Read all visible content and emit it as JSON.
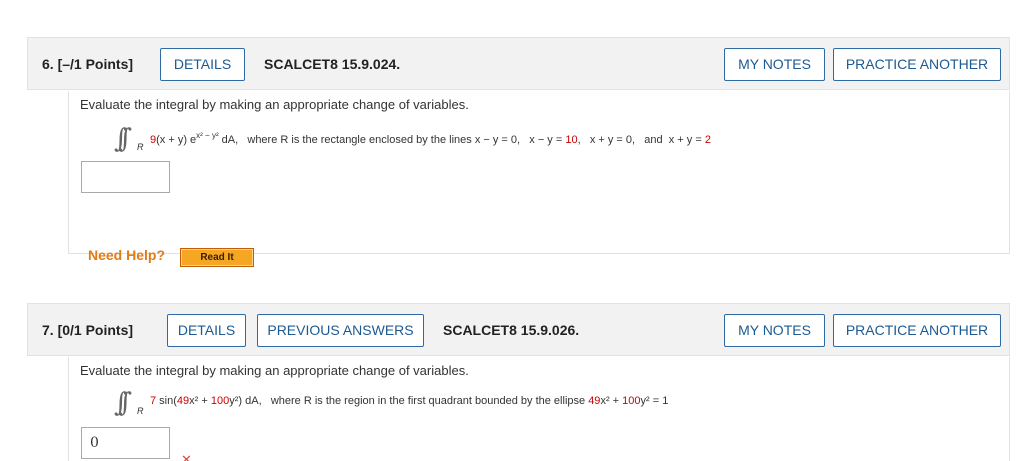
{
  "q6": {
    "number": "6.",
    "points": "[–/1 Points]",
    "details_label": "DETAILS",
    "code": "SCALCET8 15.9.024.",
    "my_notes_label": "MY NOTES",
    "practice_label": "PRACTICE ANOTHER",
    "prompt": "Evaluate the integral by making an appropriate change of variables.",
    "integral_symbol": "∫∫",
    "region_sub": "R",
    "integrand_coef": "9",
    "integrand_rest": "(x + y) e",
    "exponent": "x² − y²",
    "dA": " dA,",
    "where_text": "where R is the rectangle enclosed by the lines ",
    "line1": "x − y = 0,",
    "line2a": "x − y = ",
    "line2b": "10",
    "line2c": ",",
    "line3": "x + y = 0,",
    "and_text": "and",
    "line4a": "x + y = ",
    "line4b": "2",
    "answer_value": "",
    "need_help": "Need Help?",
    "read_it": "Read It"
  },
  "q7": {
    "number": "7.",
    "points": "[0/1 Points]",
    "details_label": "DETAILS",
    "previous_answers_label": "PREVIOUS ANSWERS",
    "code": "SCALCET8 15.9.026.",
    "my_notes_label": "MY NOTES",
    "practice_label": "PRACTICE ANOTHER",
    "prompt": "Evaluate the integral by making an appropriate change of variables.",
    "integral_symbol": "∫∫",
    "region_sub": "R",
    "integrand_coef": "7",
    "integrand_sin": " sin(",
    "a_coef": "49",
    "x2": "x²",
    "plus": " + ",
    "b_coef": "100",
    "y2": "y²",
    "close": ") dA,",
    "where_text": "where R is the region in the first quadrant bounded by the ellipse ",
    "ell_a": "49",
    "ell_x2": "x²",
    "ell_plus": " + ",
    "ell_b": "100",
    "ell_y2": "y²",
    "ell_rest": " = 1",
    "answer_value": "0",
    "status_icon": "x-icon"
  },
  "colors": {
    "accent": "#1d5a92",
    "randomized": "#cc0000",
    "help": "#e07b16",
    "incorrect": "#e0433c"
  }
}
